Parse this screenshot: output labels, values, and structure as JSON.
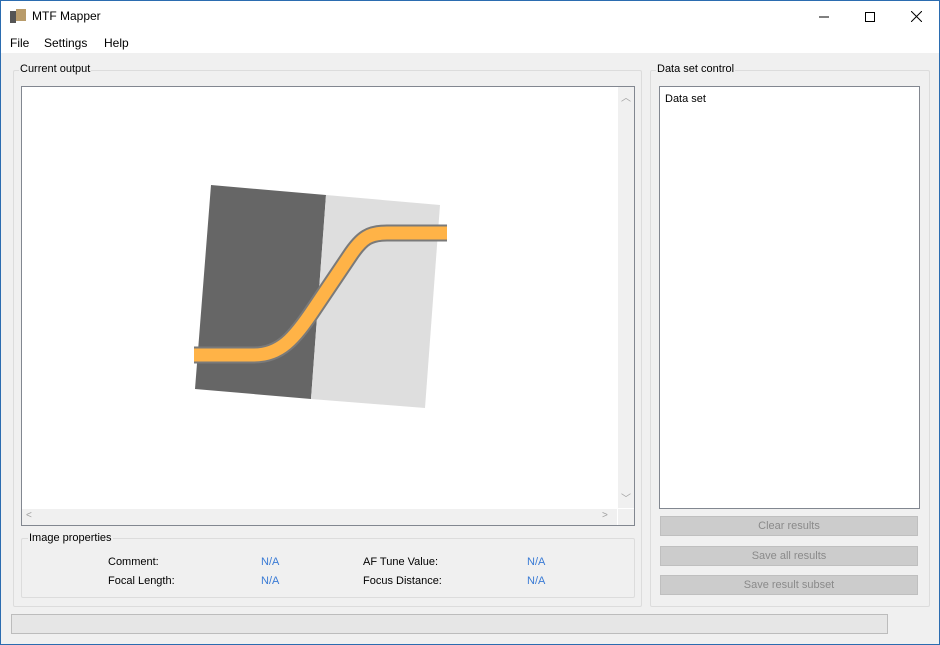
{
  "window": {
    "title": "MTF Mapper"
  },
  "menu": {
    "file": "File",
    "settings": "Settings",
    "help": "Help"
  },
  "current_output": {
    "title": "Current output"
  },
  "image_properties": {
    "title": "Image properties",
    "comment_label": "Comment:",
    "comment_value": "N/A",
    "focal_length_label": "Focal Length:",
    "focal_length_value": "N/A",
    "af_tune_label": "AF Tune Value:",
    "af_tune_value": "N/A",
    "focus_distance_label": "Focus Distance:",
    "focus_distance_value": "N/A"
  },
  "data_set_control": {
    "title": "Data set control",
    "list_header": "Data set",
    "clear_button": "Clear results",
    "save_all_button": "Save all results",
    "save_subset_button": "Save result subset"
  },
  "colors": {
    "dark_square": "#666666",
    "light_square": "#dedede",
    "curve": "#ffb347"
  }
}
